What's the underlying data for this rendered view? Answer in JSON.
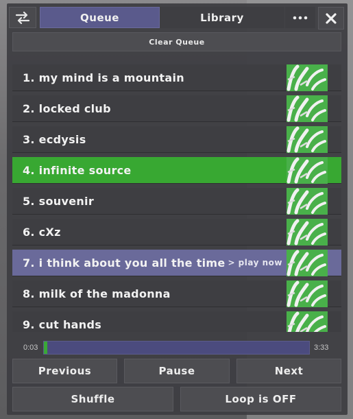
{
  "header": {
    "swap_icon": "swap-arrows-icon",
    "tabs": [
      {
        "label": "Queue",
        "active": true
      },
      {
        "label": "Library",
        "active": false
      }
    ],
    "more_icon": "more-dots-icon",
    "close_icon": "close-x-icon"
  },
  "clear_queue_label": "Clear Queue",
  "queue": [
    {
      "label": "1. my mind is a mountain",
      "state": "normal"
    },
    {
      "label": "2. locked club",
      "state": "normal"
    },
    {
      "label": "3. ecdysis",
      "state": "normal"
    },
    {
      "label": "4. infinite source",
      "state": "playing"
    },
    {
      "label": "5. souvenir",
      "state": "normal"
    },
    {
      "label": "6. cXz",
      "state": "normal"
    },
    {
      "label": "7. i think about you all the time",
      "state": "hover",
      "hint": "> play now"
    },
    {
      "label": "8. milk of the madonna",
      "state": "normal"
    },
    {
      "label": "9. cut hands",
      "state": "normal"
    }
  ],
  "player": {
    "elapsed": "0:03",
    "total": "3:33",
    "progress": 0.014
  },
  "controls": {
    "previous": "Previous",
    "pause": "Pause",
    "next": "Next",
    "shuffle": "Shuffle",
    "loop": "Loop is OFF"
  },
  "colors": {
    "accent_green": "#38a832",
    "hover_purple": "#6a6a9a",
    "tab_active": "#5a5a8c",
    "panel": "#3e3e42"
  }
}
